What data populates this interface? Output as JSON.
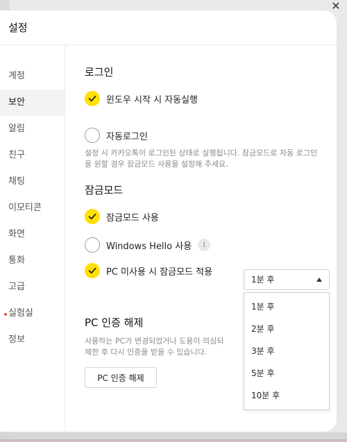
{
  "dialog": {
    "title": "설정",
    "close": "✕"
  },
  "sidebar": {
    "items": [
      {
        "label": "계정"
      },
      {
        "label": "보안"
      },
      {
        "label": "알림"
      },
      {
        "label": "친구"
      },
      {
        "label": "채팅"
      },
      {
        "label": "이모티콘"
      },
      {
        "label": "화면"
      },
      {
        "label": "통화"
      },
      {
        "label": "고급"
      },
      {
        "label": "실험실"
      },
      {
        "label": "정보"
      }
    ],
    "active": "보안"
  },
  "login": {
    "title": "로그인",
    "auto_start": {
      "label": "윈도우 시작 시 자동실행",
      "checked": true
    },
    "auto_login": {
      "label": "자동로그인",
      "checked": false
    },
    "description": "설정 시 카카오톡이 로그인된 상태로 실행됩니다. 잠금모드로 자동 로그인을 원할 경우 잠금모드 사용을 설정해 주세요."
  },
  "lock_mode": {
    "title": "잠금모드",
    "use": {
      "label": "잠금모드 사용",
      "checked": true
    },
    "windows_hello": {
      "label": "Windows Hello 사용",
      "checked": false,
      "info_icon": "i"
    },
    "pc_idle": {
      "label": "PC 미사용 시 잠금모드 적용",
      "checked": true
    },
    "select": {
      "value": "1분 후",
      "options": [
        "1분 후",
        "2분 후",
        "3분 후",
        "5분 후",
        "10분 후"
      ]
    }
  },
  "pc_auth": {
    "title": "PC 인증 해제",
    "description_line1": "사용하는 PC가 변경되었거나 도용이 의심되",
    "description_line2": "제한 후 다시 인증을 받을 수 있습니다.",
    "button": "PC 인증 해제"
  },
  "colors": {
    "accent": "#ffe000",
    "notice_dot": "#e0533c"
  }
}
